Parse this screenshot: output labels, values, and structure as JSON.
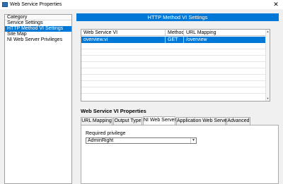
{
  "window": {
    "title": "Web Service Properties",
    "close_glyph": "✕"
  },
  "category": {
    "header": "Category",
    "items": [
      {
        "label": "Service Settings",
        "selected": false
      },
      {
        "label": "HTTP Method VI Settings",
        "selected": true
      },
      {
        "label": "Site Map",
        "selected": false
      },
      {
        "label": "NI Web Server Privileges",
        "selected": false
      }
    ]
  },
  "section_banner": "HTTP Method VI Settings",
  "vi_table": {
    "columns": [
      "Web Service VI",
      "Method",
      "URL Mapping"
    ],
    "rows": [
      {
        "vi": "overview.vi",
        "method": "GET",
        "url": "/overview",
        "selected": true
      }
    ]
  },
  "properties": {
    "heading": "Web Service VI Properties",
    "tabs": [
      {
        "label": "URL Mapping",
        "active": false
      },
      {
        "label": "Output Type",
        "active": false
      },
      {
        "label": "NI Web Server",
        "active": true
      },
      {
        "label": "Application Web Server",
        "active": false
      },
      {
        "label": "Advanced",
        "active": false
      }
    ],
    "required_privilege_label": "Required privilege",
    "required_privilege_value": "AdminRight"
  },
  "icons": {
    "app": "web-service-icon",
    "close": "close-icon",
    "dropdown": "chevron-down-icon",
    "scroll_up": "scroll-up-arrow-icon",
    "scroll_down": "scroll-down-arrow-icon"
  },
  "colors": {
    "accent": "#0078d7",
    "window_background": "#f0f0f0"
  }
}
